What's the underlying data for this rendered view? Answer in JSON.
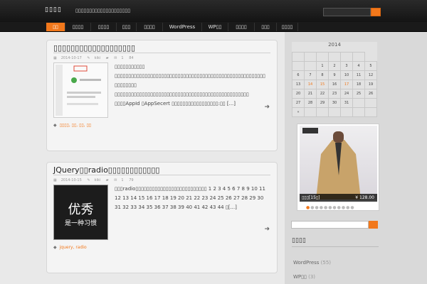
{
  "header": {
    "logo": "▯▯▯▯",
    "tagline": "▯▯▯▯▯▯▯▯▯▯▯▯▯▯▯▯▯▯▯▯",
    "search_placeholder": ""
  },
  "nav": [
    "▯▯",
    "▯▯▯▯",
    "▯▯▯▯",
    "▯▯▯",
    "▯▯▯▯",
    "WordPress",
    "WP▯▯",
    "▯▯▯▯",
    "▯▯▯",
    "▯▯▯▯"
  ],
  "posts": [
    {
      "title": "▯▯▯▯▯▯▯▯▯▯▯▯▯▯▯▯▯▯▯",
      "date": "2014-10-17",
      "author": "kiki",
      "comments": "1",
      "views": "84",
      "excerpt": "▯▯▯▯▯▯▯▯▯▯▯ ▯▯▯▯▯▯▯▯▯▯▯▯▯▯▯▯▯▯▯▯▯▯▯▯▯▯▯▯▯▯▯▯▯▯▯▯▯▯▯▯▯▯▯▯▯▯▯▯▯▯▯▯▯▯▯ ▯▯▯▯▯▯▯▯ ▯▯▯▯▯▯▯▯▯▯▯▯▯▯▯▯▯▯▯▯▯▯▯▯▯▯▯▯▯▯▯▯▯▯▯▯▯▯▯▯▯▯▯▯▯▯▯▯▯ ▯▯▯▯AppId ▯AppSecert ▯▯▯▯▯▯▯▯▯▯▯▯▯▯▯▯▯:▯▯ [...]",
      "tags": "▯▯▯▯, ▯▯, ▯▯, ▯▯"
    },
    {
      "title": "JQuery▯▯radio▯▯▯▯▯▯▯▯▯▯▯▯",
      "date": "2014-10-15",
      "author": "kiki",
      "comments": "1",
      "views": "79",
      "excerpt": "▯▯▯radio▯▯▯▯▯▯▯▯▯▯▯▯▯▯▯▯▯▯▯▯▯▯▯▯▯▯ 1 2 3 4 5 6 7 8 9 10 11 12 13 14 15 16 17 18 19 20 21 22 23 24 25 26 27 28 29 30 31 32 33 34 35 36 37 38 39 40 41 42 43 44 ▯[...]",
      "thumb_line1": "优秀",
      "thumb_line2": "是一种习惯",
      "tags": "jquery, radio"
    }
  ],
  "calendar": {
    "caption": "2014",
    "rows": [
      [
        "",
        "",
        "",
        "",
        "",
        ""
      ],
      [
        "",
        "",
        "1",
        "2",
        "3",
        "4",
        "5"
      ],
      [
        "6",
        "7",
        "8",
        "9",
        "10",
        "11",
        "12"
      ],
      [
        "13",
        "14",
        "15",
        "16",
        "17",
        "18",
        "19"
      ],
      [
        "20",
        "21",
        "22",
        "23",
        "24",
        "25",
        "26"
      ],
      [
        "27",
        "28",
        "29",
        "30",
        "31",
        "",
        ""
      ],
      [
        "«",
        "",
        "",
        "",
        "",
        "",
        ""
      ]
    ]
  },
  "slide": {
    "caption": "▯▯▯[15▯]",
    "price": "¥ 128.00"
  },
  "widget": {
    "title": "▯▯▯▯",
    "categories": [
      {
        "name": "WordPress",
        "count": "(55)"
      },
      {
        "name": "WP▯▯",
        "count": "(3)"
      }
    ]
  }
}
